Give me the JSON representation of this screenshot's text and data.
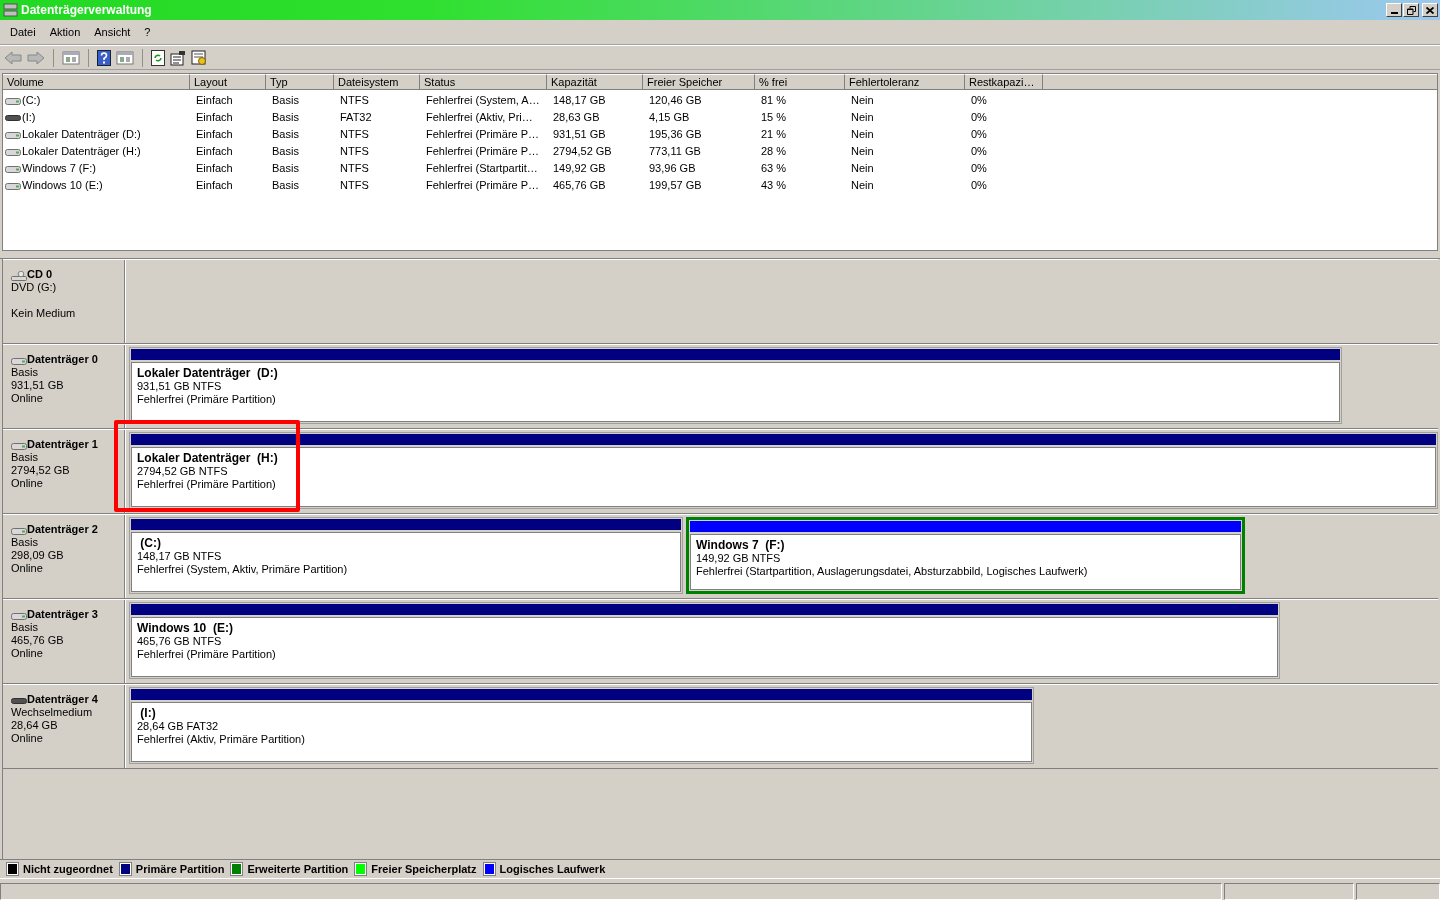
{
  "window": {
    "title": "Datenträgerverwaltung"
  },
  "menu": [
    "Datei",
    "Aktion",
    "Ansicht",
    "?"
  ],
  "table": {
    "columns": [
      "Volume",
      "Layout",
      "Typ",
      "Dateisystem",
      "Status",
      "Kapazität",
      "Freier Speicher",
      "% frei",
      "Fehlertoleranz",
      "Restkapazi…"
    ],
    "rows": [
      {
        "kind": "fixed",
        "cells": [
          "(C:)",
          "Einfach",
          "Basis",
          "NTFS",
          "Fehlerfrei (System, A…",
          "148,17 GB",
          "120,46 GB",
          "81 %",
          "Nein",
          "0%"
        ]
      },
      {
        "kind": "removable",
        "cells": [
          "(I:)",
          "Einfach",
          "Basis",
          "FAT32",
          "Fehlerfrei (Aktiv, Pri…",
          "28,63 GB",
          "4,15 GB",
          "15 %",
          "Nein",
          "0%"
        ]
      },
      {
        "kind": "fixed",
        "cells": [
          "Lokaler Datenträger (D:)",
          "Einfach",
          "Basis",
          "NTFS",
          "Fehlerfrei (Primäre P…",
          "931,51 GB",
          "195,36 GB",
          "21 %",
          "Nein",
          "0%"
        ]
      },
      {
        "kind": "fixed",
        "cells": [
          "Lokaler Datenträger (H:)",
          "Einfach",
          "Basis",
          "NTFS",
          "Fehlerfrei (Primäre P…",
          "2794,52 GB",
          "773,11 GB",
          "28 %",
          "Nein",
          "0%"
        ]
      },
      {
        "kind": "fixed",
        "cells": [
          "Windows 7 (F:)",
          "Einfach",
          "Basis",
          "NTFS",
          "Fehlerfrei (Startpartit…",
          "149,92 GB",
          "93,96 GB",
          "63 %",
          "Nein",
          "0%"
        ]
      },
      {
        "kind": "fixed",
        "cells": [
          "Windows 10 (E:)",
          "Einfach",
          "Basis",
          "NTFS",
          "Fehlerfrei (Primäre P…",
          "465,76 GB",
          "199,57 GB",
          "43 %",
          "Nein",
          "0%"
        ]
      }
    ]
  },
  "disks": [
    {
      "kind": "cdrom",
      "name": "CD 0",
      "lines": [
        "DVD (G:)",
        "Kein Medium"
      ]
    },
    {
      "kind": "fixed",
      "name": "Datenträger 0",
      "lines": [
        "Basis",
        "931,51 GB",
        "Online"
      ],
      "partitions": [
        {
          "kind": "primary",
          "selected": false,
          "highlighted": false,
          "title": "Lokaler Datenträger  (D:)",
          "size": "931,51 GB NTFS",
          "status": "Fehlerfrei (Primäre Partition)"
        }
      ]
    },
    {
      "kind": "fixed",
      "name": "Datenträger 1",
      "lines": [
        "Basis",
        "2794,52 GB",
        "Online"
      ],
      "partitions": [
        {
          "kind": "primary",
          "selected": false,
          "highlighted": true,
          "title": "Lokaler Datenträger  (H:)",
          "size": "2794,52 GB NTFS",
          "status": "Fehlerfrei (Primäre Partition)"
        }
      ]
    },
    {
      "kind": "fixed",
      "name": "Datenträger 2",
      "lines": [
        "Basis",
        "298,09 GB",
        "Online"
      ],
      "partitions": [
        {
          "kind": "primary",
          "selected": false,
          "highlighted": false,
          "title": " (C:)",
          "size": "148,17 GB NTFS",
          "status": "Fehlerfrei (System, Aktiv, Primäre Partition)"
        },
        {
          "kind": "logical",
          "selected": true,
          "highlighted": false,
          "title": "Windows 7  (F:)",
          "size": "149,92 GB NTFS",
          "status": "Fehlerfrei (Startpartition, Auslagerungsdatei, Absturzabbild, Logisches Laufwerk)"
        }
      ]
    },
    {
      "kind": "fixed",
      "name": "Datenträger 3",
      "lines": [
        "Basis",
        "465,76 GB",
        "Online"
      ],
      "partitions": [
        {
          "kind": "primary",
          "selected": false,
          "highlighted": false,
          "title": "Windows 10  (E:)",
          "size": "465,76 GB NTFS",
          "status": "Fehlerfrei (Primäre Partition)"
        }
      ]
    },
    {
      "kind": "removable",
      "name": "Datenträger 4",
      "lines": [
        "Wechselmedium",
        "28,64 GB",
        "Online"
      ],
      "partitions": [
        {
          "kind": "primary",
          "selected": false,
          "highlighted": false,
          "title": " (I:)",
          "size": "28,64 GB FAT32",
          "status": "Fehlerfrei (Aktiv, Primäre Partition)"
        }
      ]
    }
  ],
  "legend": [
    {
      "label": "Nicht zugeordnet",
      "color": "#000000"
    },
    {
      "label": "Primäre Partition",
      "color": "#000080"
    },
    {
      "label": "Erweiterte Partition",
      "color": "#008000"
    },
    {
      "label": "Freier Speicherplatz",
      "color": "#00ff00"
    },
    {
      "label": "Logisches Laufwerk",
      "color": "#0000ff"
    }
  ]
}
